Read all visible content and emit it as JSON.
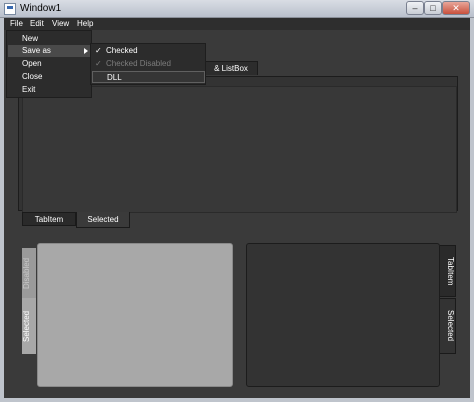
{
  "window": {
    "title": "Window1"
  },
  "menubar": {
    "items": [
      "File",
      "Edit",
      "View",
      "Help"
    ]
  },
  "file_menu": {
    "items": [
      "New",
      "Save as",
      "Open",
      "Close",
      "Exit"
    ]
  },
  "save_as_submenu": {
    "items": [
      "Checked",
      "Checked Disabled",
      "DLL"
    ]
  },
  "upper_tabs": {
    "visible_tab_label": "& ListBox"
  },
  "middle_tabs": {
    "tab1": "TabItem",
    "tab2": "Selected"
  },
  "lower_left_tabs": {
    "disabled": "Disabled",
    "selected": "Selected"
  },
  "lower_right_tabs": {
    "tabitem": "TabItem",
    "selected": "Selected"
  },
  "controls": {
    "minimize": "–",
    "maximize": "□",
    "close": "✕"
  }
}
